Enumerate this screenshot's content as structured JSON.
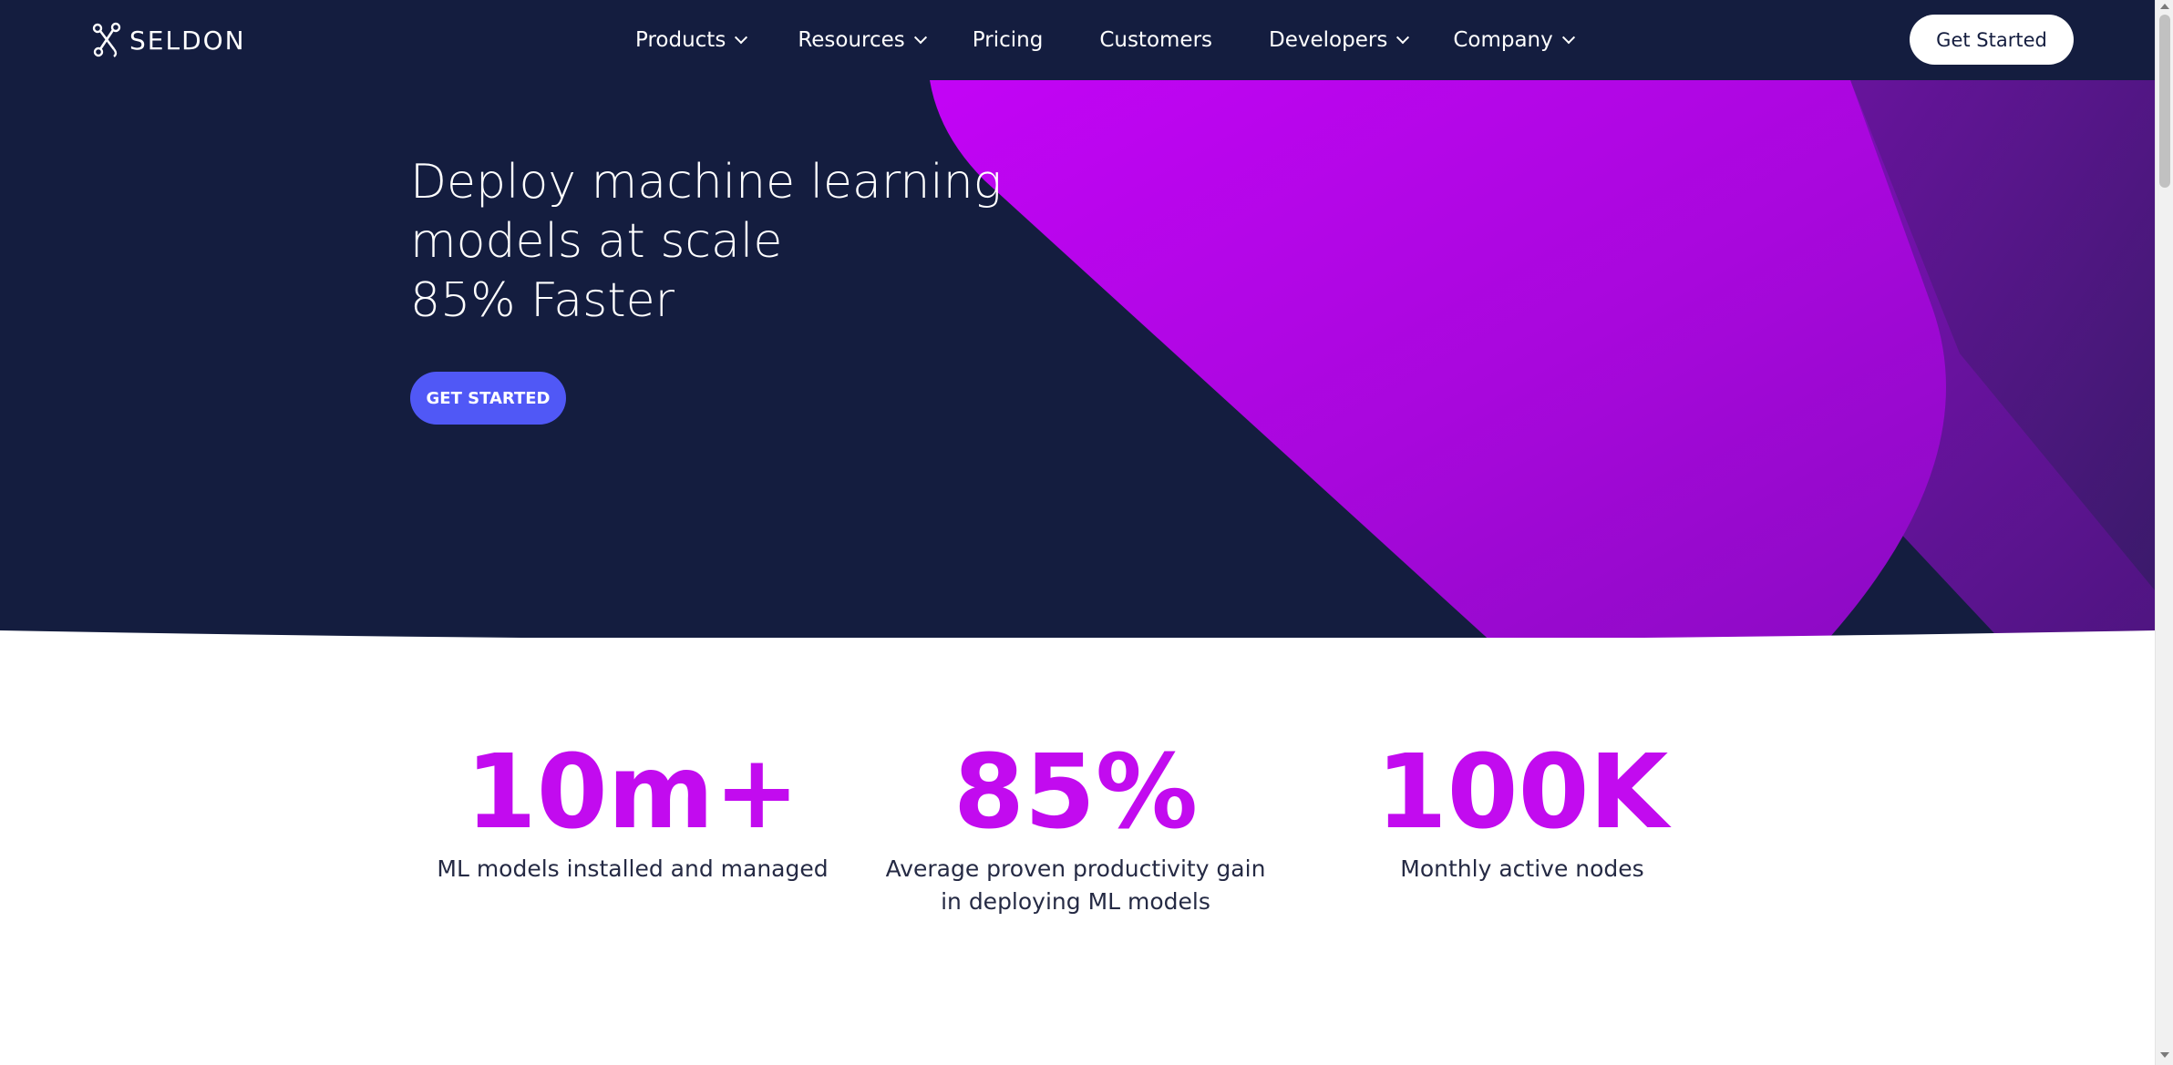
{
  "brand": {
    "name": "SELDON",
    "logo_icon": "seldon-logo-icon"
  },
  "nav": {
    "items": [
      {
        "label": "Products",
        "dropdown": true
      },
      {
        "label": "Resources",
        "dropdown": true
      },
      {
        "label": "Pricing",
        "dropdown": false
      },
      {
        "label": "Customers",
        "dropdown": false
      },
      {
        "label": "Developers",
        "dropdown": true
      },
      {
        "label": "Company",
        "dropdown": true
      }
    ],
    "cta_label": "Get Started"
  },
  "hero": {
    "title_lines": [
      "Deploy machine learning",
      "models at scale",
      "85% Faster"
    ],
    "cta_label": "GET STARTED"
  },
  "stats": [
    {
      "value": "10m+",
      "label": "ML models installed and managed"
    },
    {
      "value": "85%",
      "label": "Average proven productivity gain in deploying ML models"
    },
    {
      "value": "100K",
      "label": "Monthly active nodes"
    }
  ],
  "colors": {
    "nav_bg": "#141d3f",
    "accent_magenta": "#c20bef",
    "cta_blue": "#5058f6",
    "text_dark": "#252a44"
  }
}
